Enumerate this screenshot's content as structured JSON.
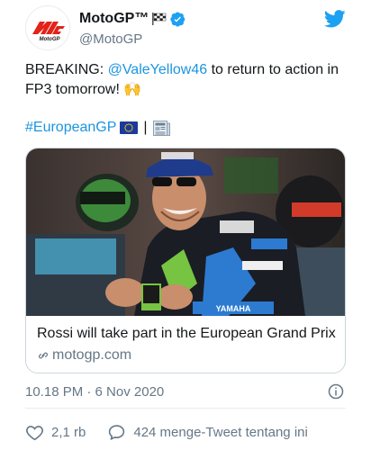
{
  "colors": {
    "accent": "#1b95e0",
    "twitter_blue": "#1da1f2",
    "secondary_text": "#657786",
    "motogp_red": "#e2231a"
  },
  "header": {
    "display_name": "MotoGP™",
    "handle": "@MotoGP",
    "avatar_icon": "motogp-logo",
    "verified_icon": "verified-badge-icon",
    "brand_icon": "twitter-bird-icon"
  },
  "tweet": {
    "text_prefix": "BREAKING: ",
    "mention": "@ValeYellow46",
    "text_suffix": " to return to action in FP3 tomorrow! 🙌",
    "hashtag": "#EuropeanGP",
    "separator": "|"
  },
  "card": {
    "title": "Rossi will take part in the European Grand Prix",
    "domain": "motogp.com",
    "image_icon": "rider-photo"
  },
  "meta": {
    "timestamp": "10.18 PM · 6 Nov 2020"
  },
  "actions": {
    "likes": "2,1 rb",
    "retweets_label": "424 menge-Tweet tentang ini"
  }
}
